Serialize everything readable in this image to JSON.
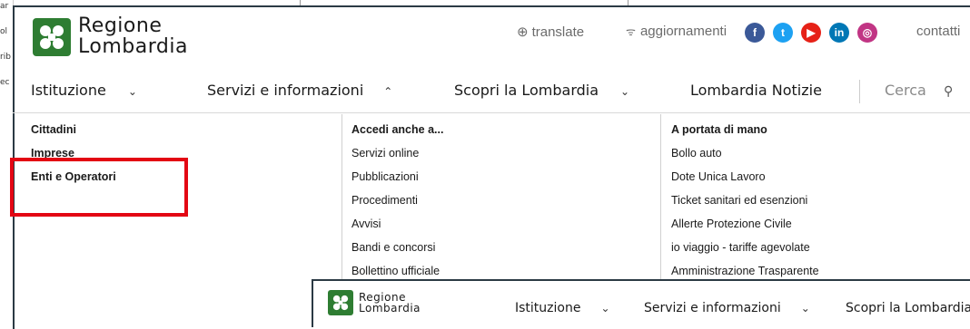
{
  "background_window": {
    "left_fragments": [
      "ar",
      "ol",
      "rib",
      "ec"
    ]
  },
  "header": {
    "logo_line1": "Regione",
    "logo_line2": "Lombardia",
    "utility": {
      "translate": "translate",
      "updates": "aggiornamenti",
      "contacts": "contatti"
    },
    "social": [
      {
        "name": "facebook-icon",
        "glyph": "f",
        "color": "#3b5998"
      },
      {
        "name": "twitter-icon",
        "glyph": "t",
        "color": "#1da1f2"
      },
      {
        "name": "youtube-icon",
        "glyph": "▶",
        "color": "#e62117"
      },
      {
        "name": "linkedin-icon",
        "glyph": "in",
        "color": "#0077b5"
      },
      {
        "name": "instagram-icon",
        "glyph": "◎",
        "color": "#c13584"
      }
    ]
  },
  "nav": {
    "items": [
      "Istituzione",
      "Servizi e informazioni",
      "Scopri la Lombardia",
      "Lombardia Notizie"
    ],
    "search_label": "Cerca"
  },
  "menu": {
    "col1": [
      "Cittadini",
      "Imprese",
      "Enti e Operatori"
    ],
    "col2_heading": "Accedi anche a...",
    "col2": [
      "Servizi online",
      "Pubblicazioni",
      "Procedimenti",
      "Avvisi",
      "Bandi e concorsi",
      "Bollettino ufficiale"
    ],
    "col3_heading": "A portata di mano",
    "col3": [
      "Bollo auto",
      "Dote Unica Lavoro",
      "Ticket sanitari ed esenzioni",
      "Allerte Protezione Civile",
      "io viaggio - tariffe agevolate",
      "Amministrazione Trasparente"
    ]
  },
  "sticky": {
    "logo_line1": "Regione",
    "logo_line2": "Lombardia",
    "items": [
      "Istituzione",
      "Servizi e informazioni",
      "Scopri la Lombardia"
    ]
  },
  "colors": {
    "brand_green": "#2e7d32",
    "highlight_red": "#e30613"
  }
}
